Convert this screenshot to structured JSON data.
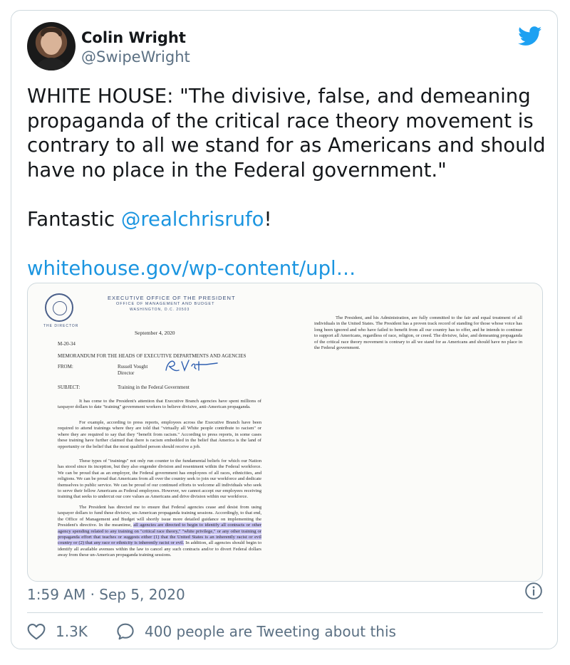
{
  "author": {
    "name": "Colin Wright",
    "handle": "@SwipeWright"
  },
  "tweet": {
    "line1": "WHITE HOUSE: \"The divisive, false, and demeaning",
    "line2": "propaganda of the critical race theory movement is",
    "line3": "contrary to all we stand for as Americans and should",
    "line4": "have no place in the Federal government.\"",
    "fantastic_prefix": "Fantastic ",
    "mention": "@realchrisrufo",
    "fantastic_suffix": "!",
    "link": "whitehouse.gov/wp-content/upl…"
  },
  "document": {
    "header1": "EXECUTIVE OFFICE OF THE PRESIDENT",
    "header2": "OFFICE OF MANAGEMENT AND BUDGET",
    "header3": "WASHINGTON, D.C. 20503",
    "director": "THE DIRECTOR",
    "date": "September 4, 2020",
    "memo_no": "M-20-34",
    "memo_title": "MEMORANDUM FOR THE HEADS OF EXECUTIVE DEPARTMENTS AND AGENCIES",
    "from_label": "FROM:",
    "from_name": "Russell Vought",
    "from_title": "Director",
    "subject_label": "SUBJECT:",
    "subject": "Training in the Federal Government",
    "p1": "It has come to the President's attention that Executive Branch agencies have spent millions of taxpayer dollars to date \"training\" government workers to believe divisive, anti-American propaganda.",
    "p2": "For example, according to press reports, employees across the Executive Branch have been required to attend trainings where they are told that \"virtually all White people contribute to racism\" or where they are required to say that they \"benefit from racism.\" According to press reports, in some cases these training have further claimed that there is racism embedded in the belief that America is the land of opportunity or the belief that the most qualified person should receive a job.",
    "p3": "These types of \"trainings\" not only run counter to the fundamental beliefs for which our Nation has stood since its inception, but they also engender division and resentment within the Federal workforce. We can be proud that as an employer, the Federal government has employees of all races, ethnicities, and religions. We can be proud that Americans from all over the country seek to join our workforce and dedicate themselves to public service. We can be proud of our continued efforts to welcome all individuals who seek to serve their fellow Americans as Federal employees. However, we cannot accept our employees receiving training that seeks to undercut our core values as Americans and drive division within our workforce.",
    "p4a": "The President has directed me to ensure that Federal agencies cease and desist from using taxpayer dollars to fund these divisive, un-American propaganda training sessions. Accordingly, to that end, the Office of Management and Budget will shortly issue more detailed guidance on implementing the President's directive. In the meantime, ",
    "p4_highlight": "all agencies are directed to begin to identify all contracts or other agency spending related to any training on \"critical race theory,\" \"white privilege,\" or any other training or propaganda effort that teaches or suggests either (1) that the United States is an inherently racist or evil country or (2) that any race or ethnicity is inherently racist or evil.",
    "p4b": " In addition, all agencies should begin to identify all available avenues within the law to cancel any such contracts and/or to divert Federal dollars away from these un-American propaganda training sessions.",
    "right": "The President, and his Administration, are fully committed to the fair and equal treatment of all individuals in the United States. The President has a proven track record of standing for those whose voice has long been ignored and who have failed to benefit from all our country has to offer, and he intends to continue to support all Americans, regardless of race, religion, or creed. The divisive, false, and demeaning propaganda of the critical race theory movement is contrary to all we stand for as Americans and should have no place in the Federal government."
  },
  "meta": {
    "timestamp": "1:59 AM · Sep 5, 2020",
    "likes": "1.3K",
    "conversation": "400 people are Tweeting about this"
  },
  "icons": {
    "brand": "twitter-bird-icon",
    "info": "info-icon",
    "like": "heart-icon",
    "reply": "speech-bubble-icon"
  },
  "colors": {
    "brand": "#1da1f2",
    "link": "#1b95e0",
    "secondary_text": "#5b7083",
    "highlight": "#c9c4f4"
  }
}
